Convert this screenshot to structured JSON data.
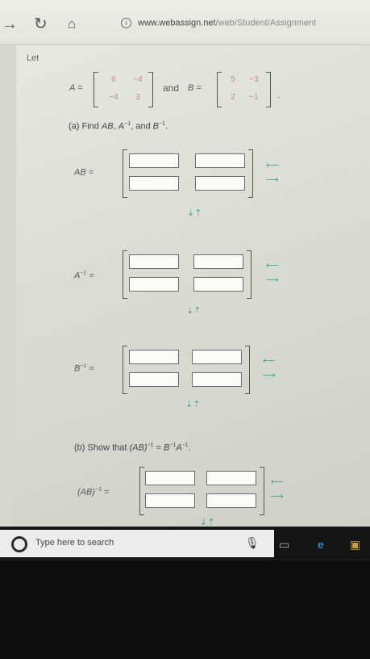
{
  "browser": {
    "url_host": "www.webassign.net",
    "url_path": "/web/Student/Assignment",
    "icons": [
      "back-arrow-icon",
      "refresh-icon",
      "home-icon",
      "info-icon"
    ]
  },
  "problem": {
    "intro": "Let",
    "matrix_a": {
      "name": "A =",
      "cells": [
        "6",
        "−4",
        "−4",
        "3"
      ]
    },
    "conj": "and",
    "matrix_b": {
      "name": "B =",
      "cells": [
        "5",
        "−3",
        "2",
        "−1"
      ]
    },
    "trailing": ".",
    "part_a": {
      "prefix": "(a) Find ",
      "t1": "AB",
      "c1": ", ",
      "t2": "A",
      "s2": "−1",
      "c2": ", and ",
      "t3": "B",
      "s3": "−1",
      "end": "."
    },
    "part_b": {
      "prefix": "(b) Show that ",
      "lhs": "(AB)",
      "lsup": "−1",
      "mid": " = ",
      "r1": "B",
      "r1sup": "−1",
      "r2": "A",
      "r2sup": "−1",
      "end": "."
    },
    "answers": [
      {
        "label": "AB",
        "sup": "",
        "eq": "="
      },
      {
        "label": "A",
        "sup": "−1",
        "eq": "="
      },
      {
        "label": "B",
        "sup": "−1",
        "eq": "="
      },
      {
        "label": "(AB)",
        "sup": "−1",
        "eq": "="
      }
    ],
    "arrows": {
      "right_top": "⟵",
      "right_bottom": "⟶",
      "down": "⇣⇡"
    }
  },
  "taskbar": {
    "search_placeholder": "Type here to search",
    "icons": [
      "cortana-icon",
      "microphone-icon",
      "task-view-icon",
      "edge-icon",
      "store-icon"
    ]
  }
}
